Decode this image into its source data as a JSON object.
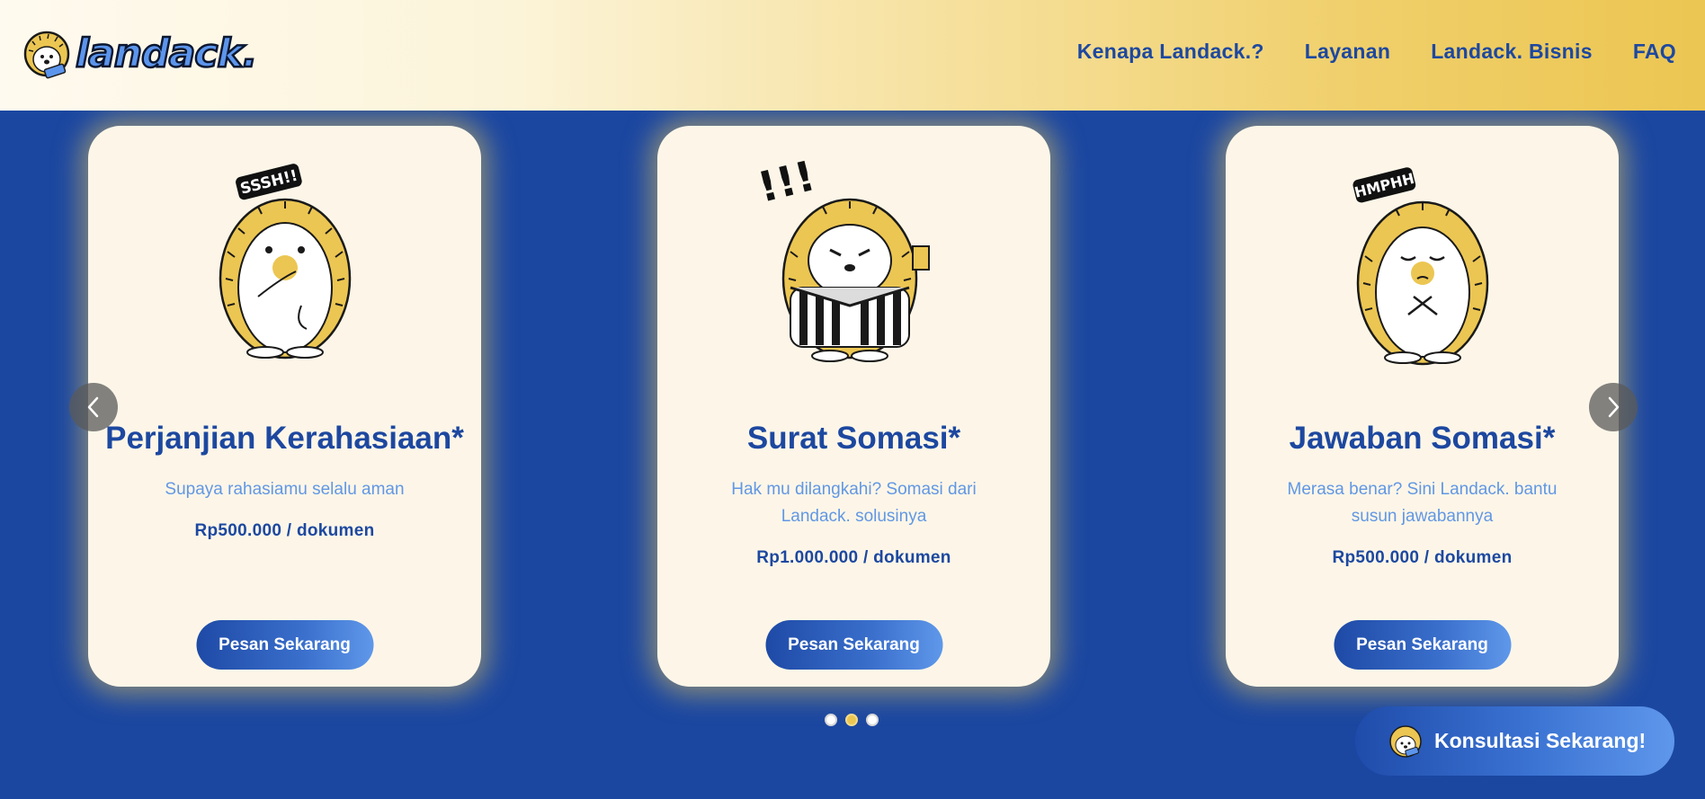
{
  "header": {
    "logo_text": "landack.",
    "nav": [
      "Kenapa Landack.?",
      "Layanan",
      "Landack. Bisnis",
      "FAQ"
    ]
  },
  "cards": [
    {
      "bubble": "SSSH!!",
      "title": "Perjanjian Kerahasiaan*",
      "description": "Supaya rahasiamu selalu aman",
      "price": "Rp500.000 / dokumen",
      "button": "Pesan Sekarang"
    },
    {
      "bubble": "!!!",
      "title": "Surat Somasi*",
      "description": "Hak mu dilangkahi? Somasi dari Landack. solusinya",
      "price": "Rp1.000.000 / dokumen",
      "button": "Pesan Sekarang"
    },
    {
      "bubble": "HMPHH",
      "title": "Jawaban Somasi*",
      "description": "Merasa benar? Sini Landack. bantu susun jawabannya",
      "price": "Rp500.000 / dokumen",
      "button": "Pesan Sekarang"
    }
  ],
  "carousel": {
    "slide_count": 3,
    "active_slide": 2
  },
  "consult_button": "Konsultasi Sekarang!",
  "icons": {
    "logo": "hedgehog-logo-icon",
    "prev": "chevron-left-icon",
    "next": "chevron-right-icon",
    "avatar": "hedgehog-avatar-icon"
  },
  "colors": {
    "brand_blue": "#1b47a1",
    "accent_yellow": "#ecc652",
    "card_bg": "#fdf6e8",
    "text_blue": "#1d48a0",
    "desc_blue": "#6197e4"
  }
}
